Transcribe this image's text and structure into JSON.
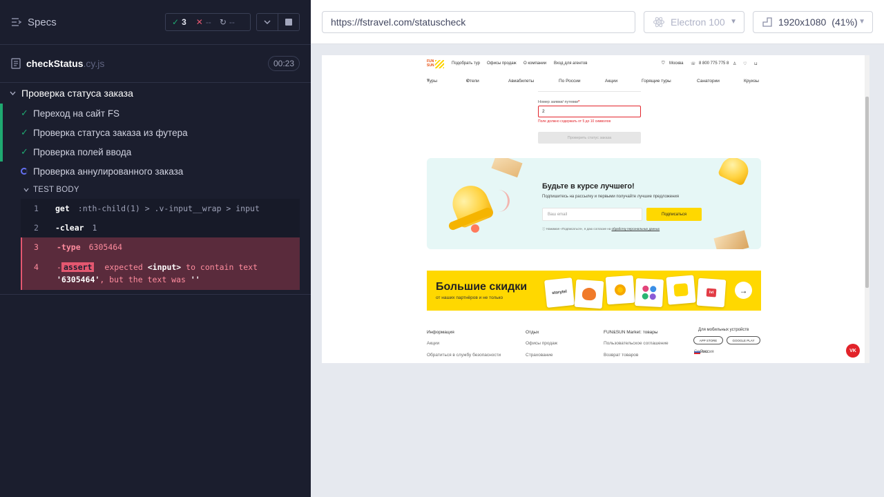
{
  "reporter": {
    "specs_label": "Specs",
    "stats": {
      "passed": "3",
      "failed": "--",
      "pending": "--"
    },
    "spec": {
      "name": "checkStatus",
      "ext": ".cy.js",
      "duration": "00:23"
    },
    "suite_title": "Проверка статуса заказа",
    "tests": [
      {
        "title": "Переход на сайт FS",
        "state": "passed"
      },
      {
        "title": "Проверка статуса заказа из футера",
        "state": "passed"
      },
      {
        "title": "Проверка полей ввода",
        "state": "passed"
      },
      {
        "title": "Проверка аннулированного заказа",
        "state": "running"
      }
    ],
    "body_label": "TEST BODY",
    "commands": [
      {
        "n": "1",
        "name": "get",
        "arg": ":nth-child(1) > .v-input__wrap > input"
      },
      {
        "n": "2",
        "name": "-clear",
        "arg": "1"
      },
      {
        "n": "3",
        "name": "-type",
        "arg": "6305464"
      },
      {
        "n": "4",
        "prefix": "-",
        "badge": "assert",
        "t1": "expected",
        "t2": "<input>",
        "t3": "to contain text",
        "t4": "'6305464'",
        "t5": ", but the text was",
        "t6": "''"
      }
    ]
  },
  "aut": {
    "url": "https://fstravel.com/statuscheck",
    "browser": "Electron 100",
    "viewport": "1920x1080",
    "scale": "(41%)"
  },
  "site": {
    "logo": {
      "line1": "FUN",
      "line2": "SUN"
    },
    "top_links": [
      "Подобрать тур",
      "Офисы продаж",
      "О компании",
      "Вход для агентов"
    ],
    "city": "Москва",
    "phone": "8 800 775 775 8",
    "menu": [
      "Туры",
      "Отели",
      "Авиабилеты",
      "По России",
      "Акции",
      "Горящие туры",
      "Санатории",
      "Круизы"
    ],
    "form": {
      "label": "Номер заявки/ путевки",
      "required_mark": "*",
      "value": "2",
      "error": "Поле должно содержать от 5 до 10 символов",
      "button": "Проверить статус заказа"
    },
    "promo": {
      "title": "Будьте в курсе лучшего!",
      "subtitle": "Подпишитесь на рассылку и первыми получайте лучшие предложения",
      "placeholder": "Ваш email",
      "button": "Подписаться",
      "note_prefix": "Нажимая «Подписаться», я даю согласие на",
      "note_link": "обработку персональных данных"
    },
    "banner": {
      "title": "Большие скидки",
      "subtitle": "от наших партнёров и не только",
      "brands": [
        "storytel",
        "",
        "",
        "",
        "",
        "ivi"
      ]
    },
    "footer": {
      "col1": [
        "Информация",
        "Акции",
        "Обратиться в службу безопасности"
      ],
      "col2": [
        "Отдых",
        "Офисы продаж",
        "Страхование"
      ],
      "col3": [
        "FUN&SUN Market: товары",
        "Пользовательское соглашение",
        "Возврат товаров"
      ],
      "mobile_title": "Для мобильных устройств",
      "app_store": "APP STORE",
      "google_play": "GOOGLE PLAY",
      "country_label": "Страна:",
      "country": "Россия"
    },
    "vk": "VK"
  }
}
